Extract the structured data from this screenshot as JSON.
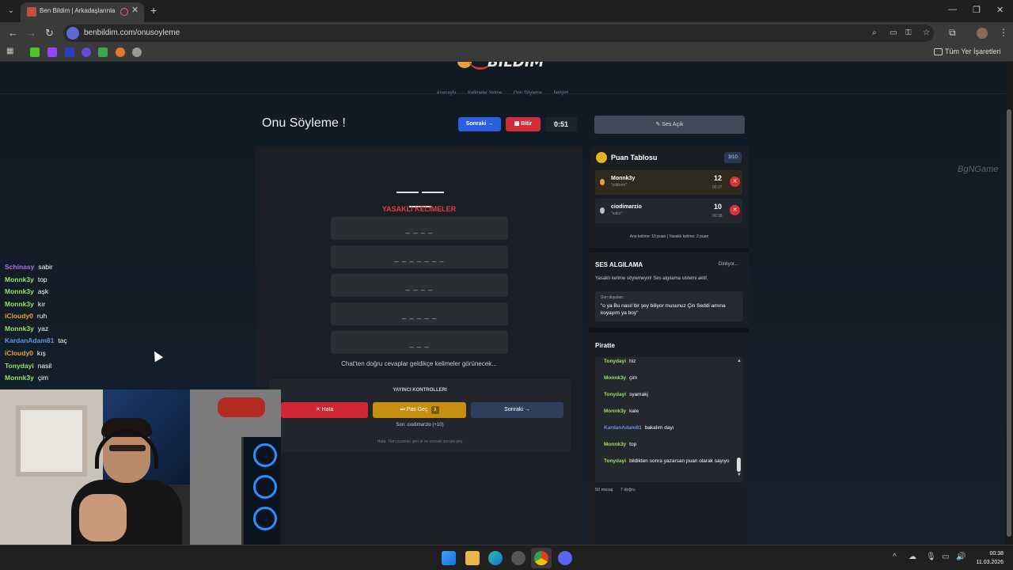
{
  "browser": {
    "tab_title": "Ben Bildim | Arkadaşlarınla",
    "tab_close": "✕",
    "new_tab": "+",
    "url": "benbildim.com/onusoyleme",
    "bookmarks_all": "Tüm Yer İşaretleri",
    "win_minimize": "—",
    "win_restore": "❐",
    "win_close": "✕"
  },
  "site": {
    "logo_text": "BILDIM",
    "nav": [
      "Anasayfa",
      "Kelimeler Yetme",
      "Onu Söyleme",
      "İletişim"
    ]
  },
  "header": {
    "title": "Onu Söyleme !",
    "next_button": "Sonraki →",
    "finish_button": "Bitir",
    "timer": "0:51",
    "sound_button": "Ses Açık"
  },
  "game": {
    "forbidden_title": "YASAKLI KELIMELER",
    "forbidden_words": [
      "_ _ _ _",
      "_ _ _ _ _ _ _",
      "_ _ _ _",
      "_ _ _ _ _",
      "_ _ _"
    ],
    "chat_hint": "Chat'ten doğru cevaplar geldikçe kelimeler görünecek..."
  },
  "controls": {
    "title": "YAYINCI KONTROLLERI",
    "error_button": "Hata",
    "pass_button": "Pas Geç",
    "pass_count": "3",
    "next_button": "Sonraki →",
    "last": "Son: ciodimarzio (+10)",
    "hint": "Hata: Tüm puanları geri al ve sonraki soruya geç"
  },
  "scoreboard": {
    "title": "Puan Tablosu",
    "count": "3/10",
    "rows": [
      {
        "name": "Monnk3y",
        "word": "\"yıldırım\"",
        "score": "12",
        "time": "00:37",
        "medal_color": "#e0a63a"
      },
      {
        "name": "ciodimarzio",
        "word": "\"sabır\"",
        "score": "10",
        "time": "00:38",
        "medal_color": "#b8c0cc"
      }
    ],
    "note": "Ana kelime: 10 puan | Yasaklı kelime: 2 puan"
  },
  "sound_detection": {
    "title": "SES ALGILAMA",
    "status": "Dinliyor...",
    "description": "Yasaklı kelime söylemeyin! Ses algılama sistemi aktif.",
    "heard_label": "Son duyulan:",
    "heard_text": "\"o ya Bu nasıl bir şey biliyor musunuz Çin Seddi amına koyayım ya boy\""
  },
  "platform_chat": {
    "title": "Piratte",
    "messages": [
      {
        "user": "Tonydayi",
        "text": "hiz",
        "color": "green"
      },
      {
        "user": "Monnk3y",
        "text": "çim",
        "color": "green"
      },
      {
        "user": "Tonydayi",
        "text": "syamakj",
        "color": "green"
      },
      {
        "user": "Monnk3y",
        "text": "kale",
        "color": "green"
      },
      {
        "user": "KardanAdam81",
        "text": "bakalım dayı",
        "color": "blue"
      },
      {
        "user": "Monnk3y",
        "text": "top",
        "color": "green"
      },
      {
        "user": "Tonydayi",
        "text": "bildikten sonra yazarsan puan olarak sayıyo",
        "color": "green"
      }
    ],
    "messages_count": "50 mesaj",
    "correct_count": "7 doğru"
  },
  "watermark": "BgNGame",
  "overlay_chat": [
    {
      "user": "Schinasy",
      "text": "sabir",
      "color": "#b072e6"
    },
    {
      "user": "Monnk3y",
      "text": "top",
      "color": "#9ee35e"
    },
    {
      "user": "Monnk3y",
      "text": "aşk",
      "color": "#9ee35e"
    },
    {
      "user": "Monnk3y",
      "text": "kır",
      "color": "#9ee35e"
    },
    {
      "user": "iCloudy0",
      "text": "ruh",
      "color": "#e6a33a"
    },
    {
      "user": "Monnk3y",
      "text": "yaz",
      "color": "#9ee35e"
    },
    {
      "user": "KardanAdam81",
      "text": "taç",
      "color": "#6a93d9"
    },
    {
      "user": "iCloudy0",
      "text": "kış",
      "color": "#e6a33a"
    },
    {
      "user": "Tonydayi",
      "text": "nasil",
      "color": "#9ee35e"
    },
    {
      "user": "Monnk3y",
      "text": "çim",
      "color": "#9ee35e"
    }
  ],
  "taskbar": {
    "time": "00:38",
    "date": "11.03.2026"
  }
}
